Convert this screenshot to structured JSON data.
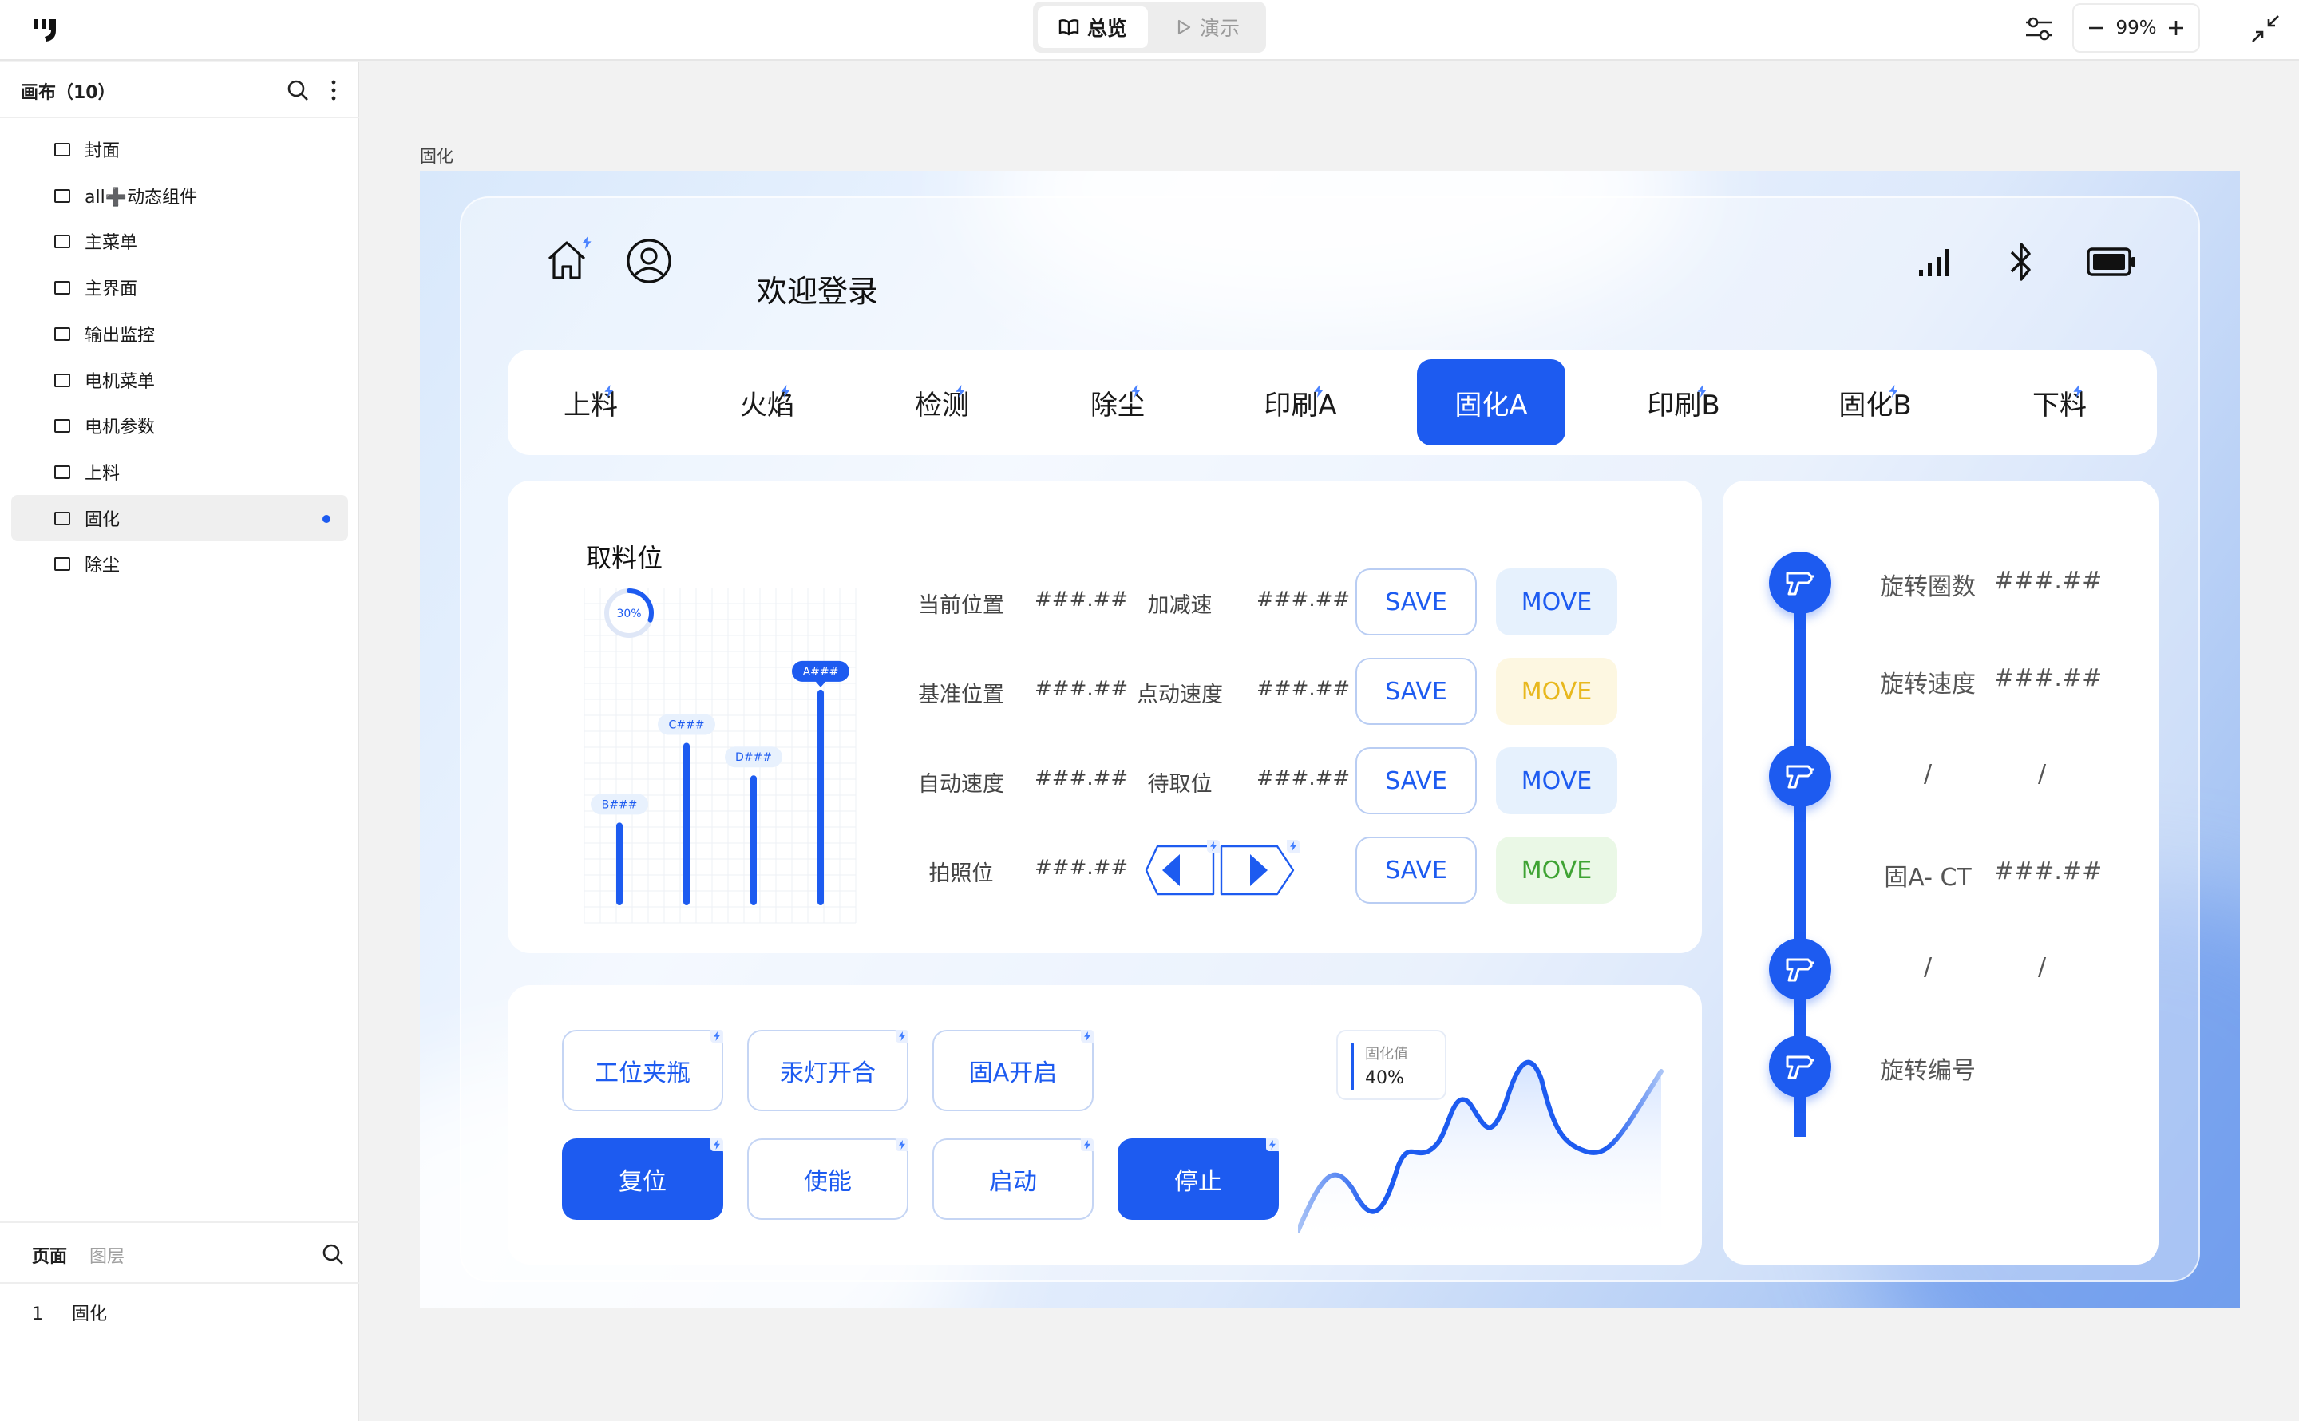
{
  "topbar": {
    "mode_overview": "总览",
    "mode_present": "演示",
    "zoom": "99%"
  },
  "left_panel": {
    "title": "画布（10）",
    "pages": [
      {
        "label": "封面"
      },
      {
        "label": "all➕动态组件"
      },
      {
        "label": "主菜单"
      },
      {
        "label": "主界面"
      },
      {
        "label": "输出监控"
      },
      {
        "label": "电机菜单"
      },
      {
        "label": "电机参数"
      },
      {
        "label": "上料"
      },
      {
        "label": "固化"
      },
      {
        "label": "除尘"
      }
    ],
    "active_index": 8,
    "tabs": {
      "pages": "页面",
      "layers": "图层"
    },
    "pagelist": {
      "num": "1",
      "label": "固化"
    }
  },
  "canvas": {
    "frame_label": "固化",
    "app": {
      "title": "欢迎登录",
      "nav_tabs": [
        "上料",
        "火焰",
        "检测",
        "除尘",
        "印刷A",
        "固化A",
        "印刷B",
        "固化B",
        "下料"
      ],
      "active_tab": 5,
      "pick": {
        "title": "取料位",
        "ring_percent": "30%",
        "sliders": [
          {
            "label": "B###",
            "level": 0.28
          },
          {
            "label": "C###",
            "level": 0.55
          },
          {
            "label": "D###",
            "level": 0.44
          },
          {
            "label": "A###",
            "level": 0.73
          }
        ],
        "rows": [
          {
            "label1": "当前位置",
            "val1": "###.##",
            "label2": "加减速",
            "val2": "###.##",
            "save": "SAVE",
            "move": "MOVE"
          },
          {
            "label1": "基准位置",
            "val1": "###.##",
            "label2": "点动速度",
            "val2": "###.##",
            "save": "SAVE",
            "move": "MOVE"
          },
          {
            "label1": "自动速度",
            "val1": "###.##",
            "label2": "待取位",
            "val2": "###.##",
            "save": "SAVE",
            "move": "MOVE"
          },
          {
            "label1": "拍照位",
            "val1": "###.##",
            "save": "SAVE",
            "move": "MOVE"
          }
        ]
      },
      "ops": {
        "row1": [
          "工位夹瓶",
          "汞灯开合",
          "固A开启"
        ],
        "row2": [
          "复位",
          "使能",
          "启动",
          "停止"
        ],
        "value_title": "固化值",
        "value": "40%"
      },
      "right": {
        "rows": [
          {
            "label": "旋转圈数",
            "value": "###.##"
          },
          {
            "label": "旋转速度",
            "value": "###.##"
          },
          {
            "label": "/",
            "value": "/"
          },
          {
            "label": "固A- CT",
            "value": "###.##"
          },
          {
            "label": "/",
            "value": "/"
          },
          {
            "label": "旋转编号",
            "value": ""
          }
        ]
      }
    }
  },
  "colors": {
    "accent": "#1d5bf0",
    "move_blue_bg": "#e6f1fd",
    "move_yellow_bg": "#fdf7e1",
    "move_yellow_text": "#e8b81e",
    "move_green_bg": "#eaf8e6",
    "move_green_text": "#3fa334"
  },
  "icons": [
    "logo-icon",
    "book-icon",
    "play-icon",
    "adjust-icon",
    "minus-icon",
    "plus-icon",
    "collapse-icon",
    "search-icon",
    "more-icon",
    "page-icon",
    "home-icon",
    "user-icon",
    "signal-icon",
    "bluetooth-icon",
    "battery-icon",
    "bolt-icon",
    "arrow-left-icon",
    "arrow-right-icon",
    "drill-icon"
  ]
}
